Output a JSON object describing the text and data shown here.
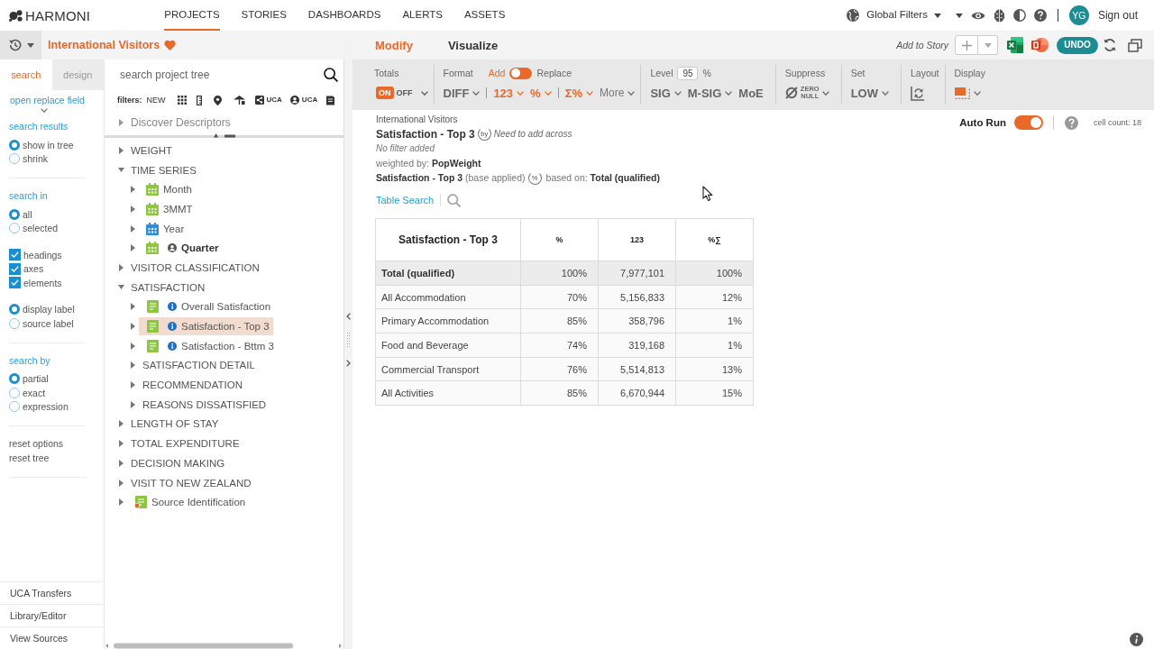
{
  "top_nav": {
    "logo": "HARMONI",
    "items": [
      {
        "label": "PROJECTS",
        "selected": true
      },
      {
        "label": "STORIES",
        "selected": false
      },
      {
        "label": "DASHBOARDS",
        "selected": false
      },
      {
        "label": "ALERTS",
        "selected": false
      },
      {
        "label": "ASSETS",
        "selected": false
      }
    ],
    "global_filters": "Global Filters",
    "avatar_initials": "YG",
    "sign_out": "Sign out"
  },
  "project": {
    "title": "International Visitors",
    "favorite": true
  },
  "left_panel": {
    "side_tabs": [
      {
        "label": "search",
        "selected": true
      },
      {
        "label": "design",
        "selected": false
      }
    ],
    "open_replace_field": "open replace field",
    "option_sections": [
      {
        "groups": [
          {
            "title": "search results",
            "kind": "radio",
            "options": [
              {
                "label": "show in tree",
                "selected": true
              },
              {
                "label": "shrink",
                "selected": false
              }
            ]
          }
        ]
      },
      {
        "groups": [
          {
            "title": "search in",
            "kind": "radio",
            "options": [
              {
                "label": "all",
                "selected": true
              },
              {
                "label": "selected",
                "selected": false
              }
            ]
          },
          {
            "kind": "checkbox",
            "options": [
              {
                "label": "headings",
                "checked": true
              },
              {
                "label": "axes",
                "checked": true
              },
              {
                "label": "elements",
                "checked": true
              }
            ]
          },
          {
            "kind": "radio",
            "options": [
              {
                "label": "display label",
                "selected": true
              },
              {
                "label": "source label",
                "selected": false
              }
            ]
          }
        ]
      },
      {
        "groups": [
          {
            "title": "search by",
            "kind": "radio",
            "options": [
              {
                "label": "partial",
                "selected": true
              },
              {
                "label": "exact",
                "selected": false
              },
              {
                "label": "expression",
                "selected": false
              }
            ]
          }
        ]
      },
      {
        "groups": [
          {
            "kind": "links",
            "options": [
              {
                "label": "reset options"
              },
              {
                "label": "reset tree"
              }
            ]
          }
        ]
      }
    ],
    "bottom_links": [
      "UCA Transfers",
      "Library/Editor",
      "View Sources"
    ]
  },
  "tree_panel": {
    "search": {
      "placeholder": "search project tree"
    },
    "filters": {
      "label": "filters:",
      "new": "NEW",
      "tags": [
        {
          "label": "UCA",
          "kind": "shared"
        },
        {
          "label": "UCA",
          "kind": "personal"
        }
      ]
    },
    "pinned": "Discover Descriptors",
    "tree": [
      {
        "label": "WEIGHT",
        "kind": "folder",
        "expanded": false,
        "selected": false
      },
      {
        "label": "TIME SERIES",
        "kind": "folder",
        "expanded": true,
        "selected": false,
        "children": [
          {
            "label": "Month",
            "kind": "calendar",
            "color": "#8dc63f",
            "expanded": false,
            "selected": false,
            "owned": false,
            "info": false,
            "flagged": false
          },
          {
            "label": "3MMT",
            "kind": "calendar",
            "color": "#8dc63f",
            "expanded": false,
            "selected": false,
            "owned": false,
            "info": false,
            "flagged": false
          },
          {
            "label": "Year",
            "kind": "calendar",
            "color": "#2b8fd8",
            "expanded": false,
            "selected": false,
            "owned": false,
            "info": false,
            "flagged": false
          },
          {
            "label": "Quarter",
            "kind": "calendar",
            "color": "#8dc63f",
            "expanded": false,
            "selected": false,
            "owned": true,
            "info": false,
            "flagged": false
          }
        ]
      },
      {
        "label": "VISITOR CLASSIFICATION",
        "kind": "folder",
        "expanded": false,
        "selected": false
      },
      {
        "label": "SATISFACTION",
        "kind": "folder",
        "expanded": true,
        "selected": false,
        "children": [
          {
            "label": "Overall Satisfaction",
            "kind": "question",
            "expanded": false,
            "selected": false,
            "owned": false,
            "info": true,
            "flagged": false
          },
          {
            "label": "Satisfaction - Top 3",
            "kind": "question",
            "expanded": false,
            "selected": true,
            "owned": false,
            "info": true,
            "flagged": false
          },
          {
            "label": "Satisfaction - Bttm 3",
            "kind": "question",
            "expanded": false,
            "selected": false,
            "owned": false,
            "info": true,
            "flagged": false
          },
          {
            "label": "SATISFACTION DETAIL",
            "kind": "folder",
            "expanded": false,
            "selected": false
          },
          {
            "label": "RECOMMENDATION",
            "kind": "folder",
            "expanded": false,
            "selected": false
          },
          {
            "label": "REASONS DISSATISFIED",
            "kind": "folder",
            "expanded": false,
            "selected": false
          }
        ]
      },
      {
        "label": "LENGTH OF STAY",
        "kind": "folder",
        "expanded": false,
        "selected": false
      },
      {
        "label": "TOTAL EXPENDITURE",
        "kind": "folder",
        "expanded": false,
        "selected": false
      },
      {
        "label": "DECISION MAKING",
        "kind": "folder",
        "expanded": false,
        "selected": false
      },
      {
        "label": "VISIT TO NEW ZEALAND",
        "kind": "folder",
        "expanded": false,
        "selected": false
      },
      {
        "label": "Source Identification",
        "kind": "question",
        "expanded": false,
        "selected": false,
        "owned": false,
        "info": false,
        "flagged": true
      }
    ]
  },
  "mode_tabs": [
    {
      "label": "Modify",
      "selected": true
    },
    {
      "label": "Visualize",
      "selected": false
    }
  ],
  "story_bar": {
    "add_to_story": "Add to Story",
    "undo": "UNDO"
  },
  "toolbar": {
    "totals": {
      "label": "Totals",
      "on_text": "ON",
      "off_text": "OFF",
      "on": true
    },
    "format": {
      "label": "Format",
      "modes": [
        {
          "label": "Add",
          "selected": true
        },
        {
          "label": "Replace",
          "selected": false
        }
      ],
      "button_groups": [
        {
          "buttons": [
            {
              "label": "DIFF",
              "kind": "option",
              "active": false,
              "dropdown": true
            }
          ]
        },
        {
          "buttons": [
            {
              "label": "123",
              "kind": "option",
              "active": true,
              "dropdown": true
            },
            {
              "label": "%",
              "kind": "option",
              "active": true,
              "dropdown": true
            }
          ]
        },
        {
          "buttons": [
            {
              "label": "Σ%",
              "kind": "option",
              "active": true,
              "dropdown": true
            },
            {
              "label": "More",
              "kind": "menu",
              "active": false,
              "dropdown": true
            }
          ]
        }
      ]
    },
    "level": {
      "label": "Level",
      "value": "95",
      "unit": "%",
      "buttons": [
        {
          "label": "SIG",
          "dropdown": true
        },
        {
          "label": "M-SIG",
          "dropdown": true
        },
        {
          "label": "MoE",
          "dropdown": false
        }
      ]
    },
    "suppress": {
      "label": "Suppress",
      "lines": [
        "ZERO",
        "NULL"
      ]
    },
    "set": {
      "label": "Set",
      "value": "LOW"
    },
    "layout": {
      "label": "Layout"
    },
    "display": {
      "label": "Display"
    }
  },
  "report": {
    "project": "International Visitors",
    "title": "Satisfaction - Top 3",
    "across_badge": "by",
    "across_hint": "Need to add across",
    "filter_note": "No filter added",
    "weighting": "weighted by: **PopWeight**",
    "base": "**Satisfaction - Top 3** (base applied)",
    "base_badge": "%",
    "based_on": "based on: **Total (qualified)**",
    "table_search": "Table Search",
    "auto_run": {
      "label": "Auto Run",
      "on": true
    },
    "cell_count": "cell count: 18"
  },
  "table": {
    "columns": [
      "Satisfaction - Top 3",
      "%",
      "123",
      "%∑"
    ],
    "rows": [
      {
        "kind": "total",
        "cells": [
          "Total (qualified)",
          "100%",
          "7,977,101",
          "100%"
        ]
      },
      {
        "kind": "data",
        "cells": [
          "All Accommodation",
          "70%",
          "5,156,833",
          "12%"
        ]
      },
      {
        "kind": "data",
        "cells": [
          "Primary Accommodation",
          "85%",
          "358,796",
          "1%"
        ]
      },
      {
        "kind": "data",
        "cells": [
          "Food and Beverage",
          "74%",
          "319,168",
          "1%"
        ]
      },
      {
        "kind": "data",
        "cells": [
          "Commercial Transport",
          "76%",
          "5,514,813",
          "13%"
        ]
      },
      {
        "kind": "data",
        "cells": [
          "All Activities",
          "85%",
          "6,670,944",
          "15%"
        ]
      }
    ]
  }
}
